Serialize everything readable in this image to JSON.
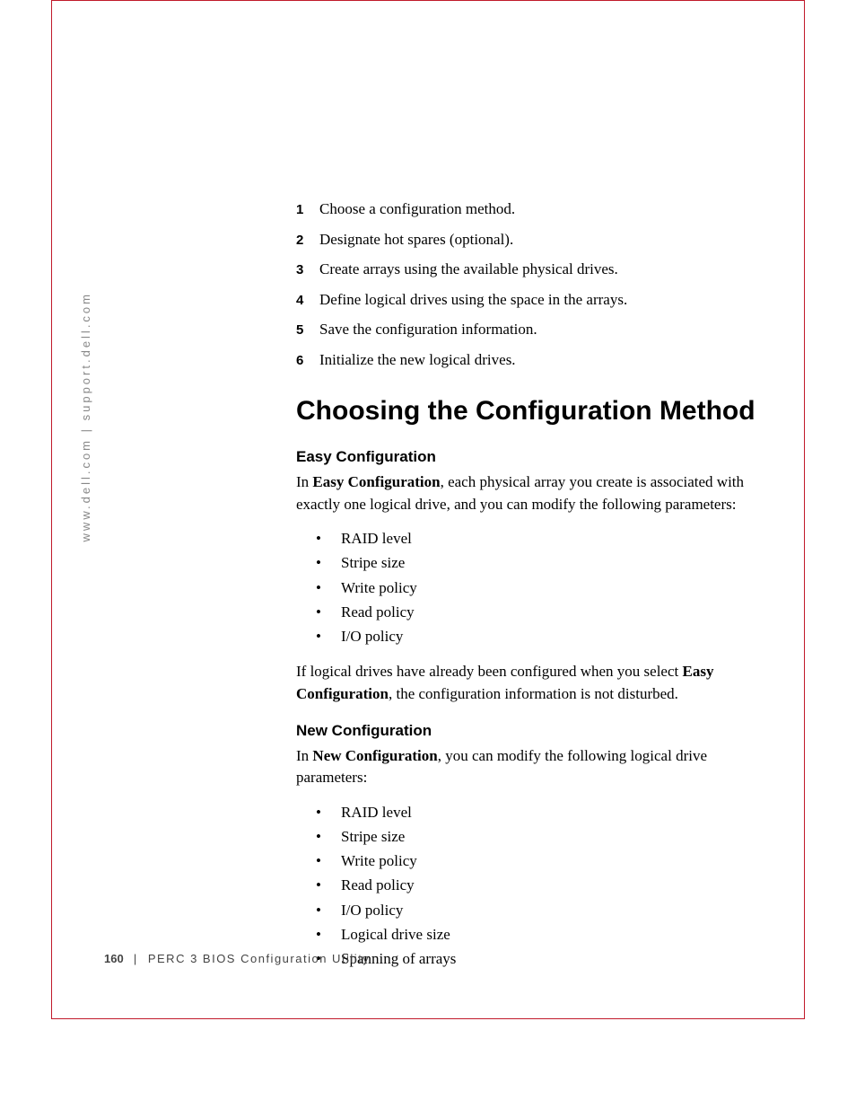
{
  "side_url": "www.dell.com | support.dell.com",
  "steps": [
    "Choose a configuration method.",
    "Designate hot spares (optional).",
    "Create arrays using the available physical drives.",
    "Define logical drives using the space in the arrays.",
    "Save the configuration information.",
    "Initialize the new logical drives."
  ],
  "heading": "Choosing the Configuration Method",
  "easy": {
    "title": "Easy Configuration",
    "intro_prefix": "In ",
    "intro_bold": "Easy Configuration",
    "intro_suffix": ", each physical array you create is associated with exactly one logical drive, and you can modify the following parameters:",
    "bullets": [
      "RAID level",
      "Stripe size",
      "Write policy",
      "Read policy",
      "I/O policy"
    ],
    "after_prefix": "If logical drives have already been configured when you select ",
    "after_bold": "Easy Configuration",
    "after_suffix": ", the configuration information is not disturbed."
  },
  "new": {
    "title": "New Configuration",
    "intro_prefix": "In ",
    "intro_bold": "New Configuration",
    "intro_suffix": ", you can modify the following logical drive parameters:",
    "bullets": [
      "RAID level",
      "Stripe size",
      "Write policy",
      "Read policy",
      "I/O policy",
      "Logical drive size",
      "Spanning of arrays"
    ]
  },
  "footer": {
    "page": "160",
    "title": "PERC 3 BIOS Configuration Utility"
  }
}
